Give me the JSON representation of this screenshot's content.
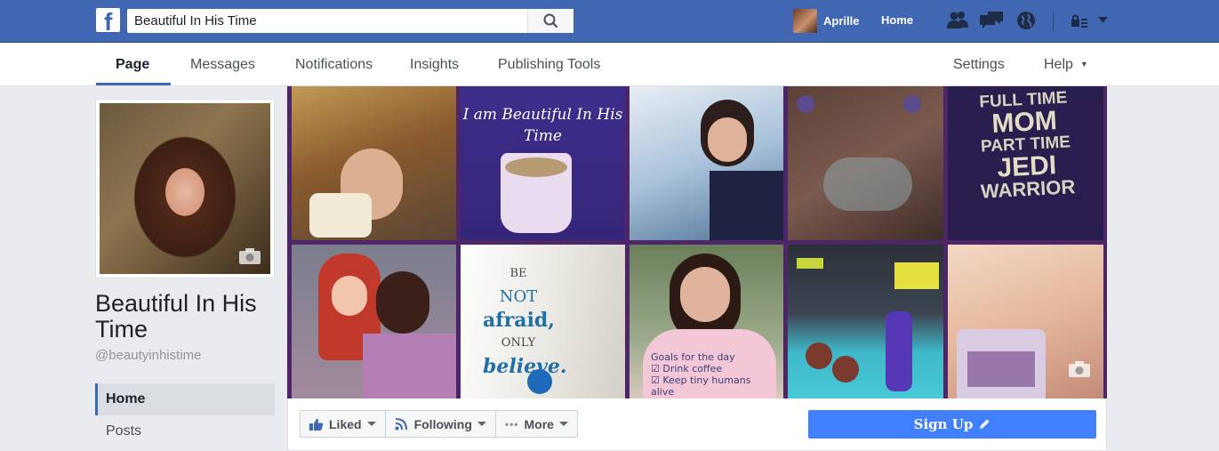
{
  "topbar": {
    "logo": "f",
    "search_value": "Beautiful In His Time",
    "user_name": "Aprille",
    "home_label": "Home"
  },
  "subnav": {
    "tabs": [
      "Page",
      "Messages",
      "Notifications",
      "Insights",
      "Publishing Tools"
    ],
    "settings_label": "Settings",
    "help_label": "Help"
  },
  "sidebar": {
    "page_name": "Beautiful In His Time",
    "handle": "@beautyinhistime",
    "items": [
      "Home",
      "Posts"
    ]
  },
  "cover": {
    "tile2_text": "I am Beautiful In His Time",
    "tile5_lines": [
      "FULL TIME",
      "MOM",
      "PART TIME",
      "JEDI",
      "WARRIOR"
    ],
    "tile7_lines": [
      "BE",
      "NOT",
      "afraid,",
      "ONLY",
      "believe."
    ],
    "tile8_lines": [
      "Goals for the day",
      "☑ Drink coffee",
      "☑ Keep tiny humans alive"
    ]
  },
  "actions": {
    "liked_label": "Liked",
    "following_label": "Following",
    "more_label": "More",
    "signup_label": "Sign Up"
  },
  "colors": {
    "brand": "#4267b2",
    "signup": "#4080ff",
    "cover_frame": "#4d2667"
  }
}
